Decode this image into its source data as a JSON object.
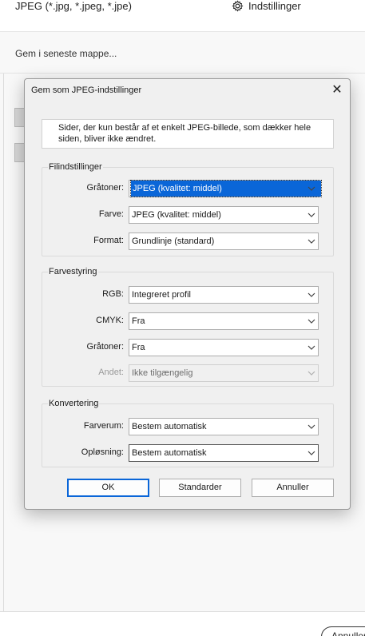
{
  "background": {
    "filetype_label": "JPEG (*.jpg, *.jpeg, *.jpe)",
    "settings_label": "Indstillinger",
    "recent_label": "Gem i seneste mappe...",
    "bottom_button": "Annuller"
  },
  "dialog": {
    "title": "Gem som JPEG-indstillinger",
    "info": "Sider, der kun består af et enkelt JPEG-billede, som dækker hele siden, bliver ikke ændret.",
    "groups": {
      "file": {
        "label": "Filindstillinger",
        "rows": [
          {
            "label": "Gråtoner:",
            "value": "JPEG (kvalitet: middel)"
          },
          {
            "label": "Farve:",
            "value": "JPEG (kvalitet: middel)"
          },
          {
            "label": "Format:",
            "value": "Grundlinje (standard)"
          }
        ]
      },
      "color": {
        "label": "Farvestyring",
        "rows": [
          {
            "label": "RGB:",
            "value": "Integreret profil"
          },
          {
            "label": "CMYK:",
            "value": "Fra"
          },
          {
            "label": "Gråtoner:",
            "value": "Fra"
          },
          {
            "label": "Andet:",
            "value": "Ikke tilgængelig"
          }
        ]
      },
      "convert": {
        "label": "Konvertering",
        "rows": [
          {
            "label": "Farverum:",
            "value": "Bestem automatisk"
          },
          {
            "label": "Opløsning:",
            "value": "Bestem automatisk"
          }
        ]
      }
    },
    "buttons": {
      "ok": "OK",
      "defaults": "Standarder",
      "cancel": "Annuller"
    }
  },
  "colors": {
    "accent": "#0a66d8",
    "dialog_bg": "#f0f0f0"
  }
}
